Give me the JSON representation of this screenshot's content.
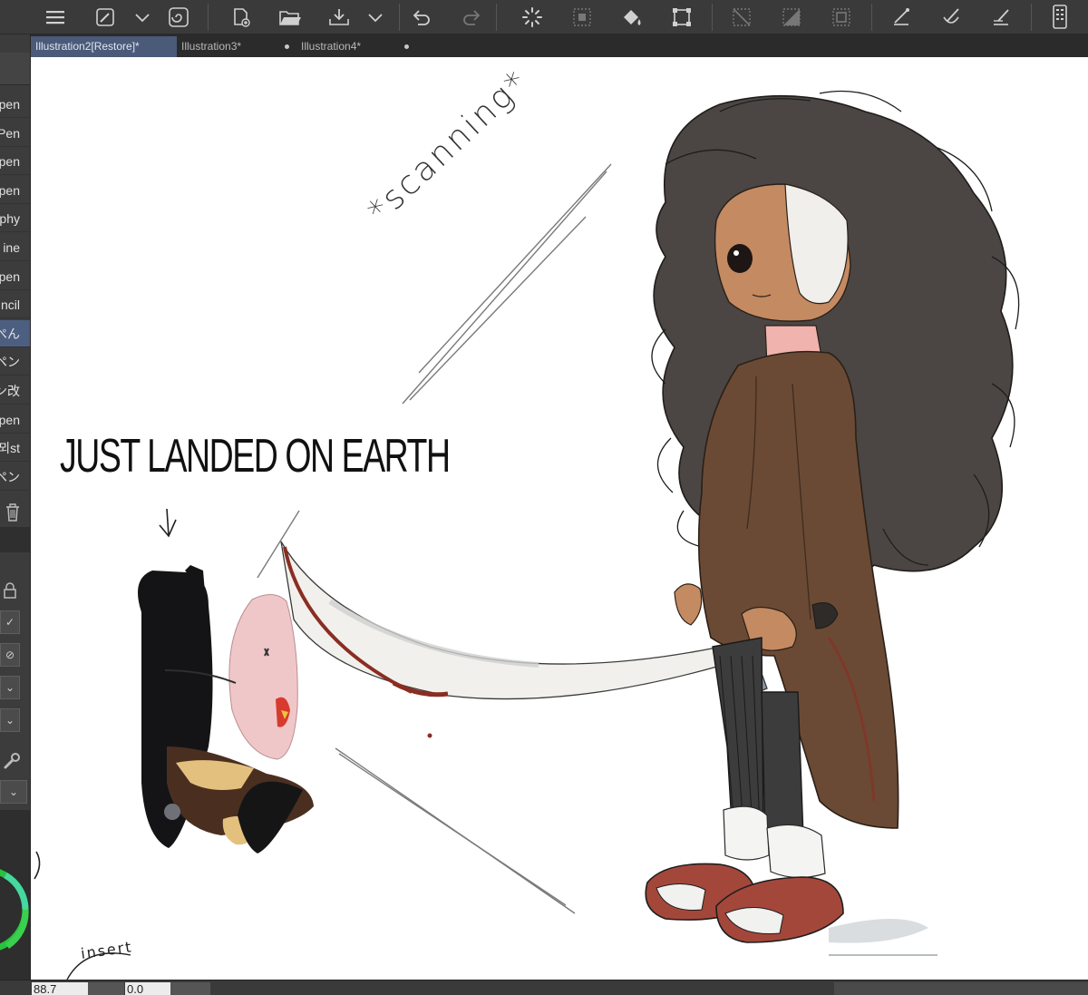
{
  "toolbar": {
    "icons": [
      "menu-icon",
      "brush-settings-icon",
      "chevron-down-icon",
      "spiral-icon",
      "new-document-icon",
      "open-folder-icon",
      "save-icon",
      "chevron-down-icon",
      "undo-icon",
      "redo-icon",
      "loading-spinner-icon",
      "clear-selection-icon",
      "fill-icon",
      "transform-icon",
      "hide-selection-icon",
      "invert-selection-icon",
      "border-selection-icon",
      "ruler-line-icon",
      "ruler-curve-icon",
      "ruler-perspective-icon",
      "smartphone-icon"
    ]
  },
  "tabs": [
    {
      "label": "Illustration2[Restore]*",
      "active": true
    },
    {
      "label": "Illustration3*",
      "active": false
    },
    {
      "label": "Illustration4*",
      "active": false
    }
  ],
  "brushes": [
    "pen",
    "Pen",
    "pen",
    "pen",
    "phy",
    "ine",
    "pen",
    "ncil",
    "ぺん",
    "ペン",
    "ン改",
    "pen",
    "뫼st",
    "ペン"
  ],
  "selected_brush_index": 8,
  "canvas": {
    "caption": "JUST LANDED ON EARTH",
    "scanning_text": "*scanning*",
    "insert_text": "insert"
  },
  "statusbar": {
    "zoom": "88.7",
    "angle": "0.0"
  },
  "colors": {
    "accent": "#4a5a78",
    "canvas": "#ffffff",
    "ui_dark": "#3a3a3a",
    "hair": "#3a3835",
    "coat": "#6b4a35",
    "shoes": "#a4473b",
    "blood": "#8a2d22"
  }
}
